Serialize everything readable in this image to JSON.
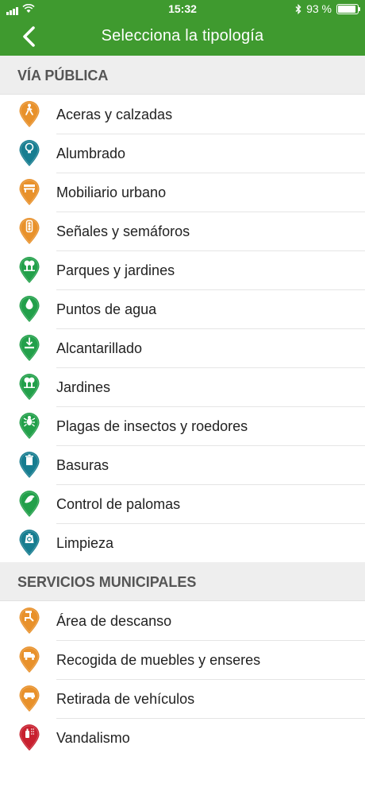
{
  "status_bar": {
    "time": "15:32",
    "battery_percent": "93 %",
    "battery_level": 0.93
  },
  "nav": {
    "title": "Selecciona la tipología",
    "back_icon": "chevron-left-icon"
  },
  "colors": {
    "header_green": "#3f9a2f",
    "orange": "#e8912b",
    "teal": "#1a8a8f",
    "green": "#2aa04a",
    "red": "#c8202f"
  },
  "sections": [
    {
      "title": "VÍA PÚBLICA",
      "items": [
        {
          "label": "Aceras y calzadas",
          "icon": "pedestrian-icon",
          "color": "#e8912b"
        },
        {
          "label": "Alumbrado",
          "icon": "light-bulb-icon",
          "color": "#177d90"
        },
        {
          "label": "Mobiliario urbano",
          "icon": "bench-icon",
          "color": "#e8912b"
        },
        {
          "label": "Señales y semáforos",
          "icon": "traffic-light-icon",
          "color": "#e8912b"
        },
        {
          "label": "Parques y jardines",
          "icon": "park-tree-icon",
          "color": "#22a04a"
        },
        {
          "label": "Puntos de agua",
          "icon": "water-drop-icon",
          "color": "#22a04a"
        },
        {
          "label": "Alcantarillado",
          "icon": "drain-icon",
          "color": "#22a04a"
        },
        {
          "label": "Jardines",
          "icon": "garden-tree-icon",
          "color": "#22a04a"
        },
        {
          "label": "Plagas de insectos y roedores",
          "icon": "bug-icon",
          "color": "#22a04a"
        },
        {
          "label": "Basuras",
          "icon": "trash-icon",
          "color": "#177d90"
        },
        {
          "label": "Control de palomas",
          "icon": "pigeon-icon",
          "color": "#22a04a"
        },
        {
          "label": "Limpieza",
          "icon": "recycle-bag-icon",
          "color": "#177d90"
        }
      ]
    },
    {
      "title": "SERVICIOS MUNICIPALES",
      "items": [
        {
          "label": " Área de descanso",
          "icon": "rest-area-icon",
          "color": "#e8912b"
        },
        {
          "label": "Recogida de muebles y enseres",
          "icon": "truck-icon",
          "color": "#e8912b"
        },
        {
          "label": "Retirada de vehículos",
          "icon": "car-icon",
          "color": "#e8912b"
        },
        {
          "label": "Vandalismo",
          "icon": "graffiti-icon",
          "color": "#c8202f"
        }
      ]
    }
  ]
}
